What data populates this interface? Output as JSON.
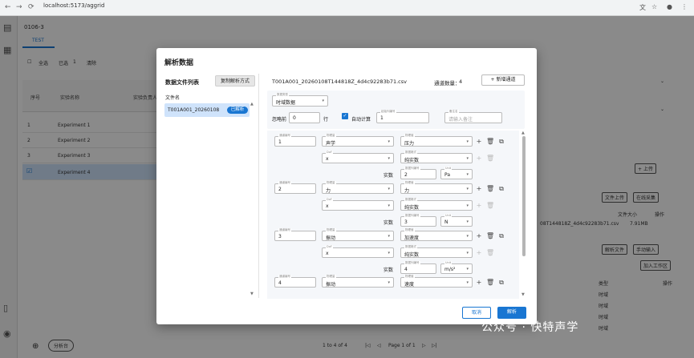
{
  "browser": {
    "url": "localhost:5173/aggrid"
  },
  "app": {
    "title": "0106-3",
    "tab": "TEST",
    "toolbar": {
      "select_all": "全选",
      "selected_label": "已选",
      "selected_count": "1",
      "clear": "清除"
    },
    "table": {
      "headers": [
        "序号",
        "实验名称",
        "实验负责人"
      ],
      "rows": [
        {
          "no": "1",
          "name": "Experiment 1"
        },
        {
          "no": "2",
          "name": "Experiment 2"
        },
        {
          "no": "3",
          "name": "Experiment 3"
        },
        {
          "no": "",
          "name": "Experiment 4"
        }
      ]
    },
    "right_panel": {
      "upload": "上传",
      "file_upload": "文件上传",
      "online_collect": "在线采集",
      "file_size_h": "文件大小",
      "ops_h": "操作",
      "file_row": "08T144818Z_4d4c92283b71.csv",
      "file_size": "7.91MB",
      "parse_file": "解析文件",
      "manual_input": "手动输入",
      "add_workspace": "加入工作区",
      "type_h": "类型",
      "ops_h2": "操作",
      "type_rows": [
        "时域",
        "时域",
        "时域",
        "时域"
      ]
    },
    "pagination": {
      "info": "1 to 4 of 4",
      "page": "Page 1 of 1"
    },
    "bottom": {
      "analysis": "分析台"
    }
  },
  "dialog": {
    "title": "解析数据",
    "file_list_title": "数据文件列表",
    "copy_method": "复制解析方式",
    "file_name_label": "文件名",
    "file_item": "T001A001_20260108",
    "parsed_badge": "已解析",
    "current_file": "T001A001_20260108T144818Z_4d4c92283b71.csv",
    "channel_count_label": "通道数量：",
    "channel_count": "4",
    "add_channel": "新增通道",
    "data_type": {
      "label": "数据类型",
      "value": "时域数据"
    },
    "skip_prefix": "忽略前",
    "skip_value": "0",
    "skip_suffix": "行",
    "auto_calc": "自动计算",
    "start_col": {
      "label": "起始列编号",
      "value": "1"
    },
    "remark": {
      "label": "备注名",
      "placeholder": "请输入备注"
    },
    "channels": [
      {
        "ch_label": "通道编号",
        "ch": "1",
        "qty_label": "物理量",
        "qty": "声学",
        "qty2_label": "物理值",
        "qty2": "压力",
        "dof_label": "DoF",
        "dof": "x",
        "fmt_label": "数据格式",
        "fmt": "纯实数",
        "real": "实数",
        "col_label": "数据列编号",
        "col": "2",
        "unit_label": "Unit",
        "unit": "Pa"
      },
      {
        "ch_label": "通道编号",
        "ch": "2",
        "qty_label": "物理量",
        "qty": "力",
        "qty2_label": "物理值",
        "qty2": "力",
        "dof_label": "DoF",
        "dof": "x",
        "fmt_label": "数据格式",
        "fmt": "纯实数",
        "real": "实数",
        "col_label": "数据列编号",
        "col": "3",
        "unit_label": "Unit",
        "unit": "N"
      },
      {
        "ch_label": "通道编号",
        "ch": "3",
        "qty_label": "物理量",
        "qty": "振动",
        "qty2_label": "物理值",
        "qty2": "加速度",
        "dof_label": "DoF",
        "dof": "x",
        "fmt_label": "数据格式",
        "fmt": "纯实数",
        "real": "实数",
        "col_label": "数据列编号",
        "col": "4",
        "unit_label": "Unit",
        "unit": "m/s²"
      },
      {
        "ch_label": "通道编号",
        "ch": "4",
        "qty_label": "物理量",
        "qty": "振动",
        "qty2_label": "物理值",
        "qty2": "速度"
      }
    ],
    "cancel": "取消",
    "parse": "解析"
  },
  "watermark": "公众号 · 快特声学"
}
